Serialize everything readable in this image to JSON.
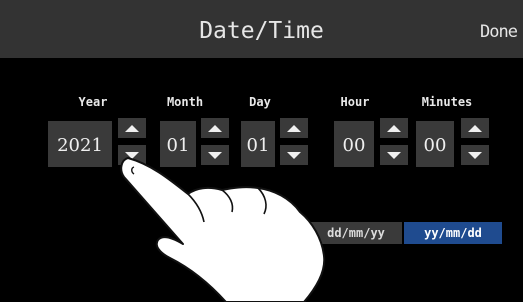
{
  "header": {
    "title": "Date/Time",
    "done_label": "Done"
  },
  "fields": {
    "year": {
      "label": "Year",
      "value": "2021"
    },
    "month": {
      "label": "Month",
      "value": "01"
    },
    "day": {
      "label": "Day",
      "value": "01"
    },
    "hour": {
      "label": "Hour",
      "value": "00"
    },
    "minutes": {
      "label": "Minutes",
      "value": "00"
    }
  },
  "format": {
    "options": [
      "dd/mm/yy",
      "yy/mm/dd"
    ],
    "selected": "yy/mm/dd"
  },
  "colors": {
    "header_bg": "#333333",
    "selected_accent": "#1f4b8f"
  },
  "icons": {
    "increment": "triangle-up-icon",
    "decrement": "triangle-down-icon",
    "pointer": "hand-pointer-icon"
  }
}
